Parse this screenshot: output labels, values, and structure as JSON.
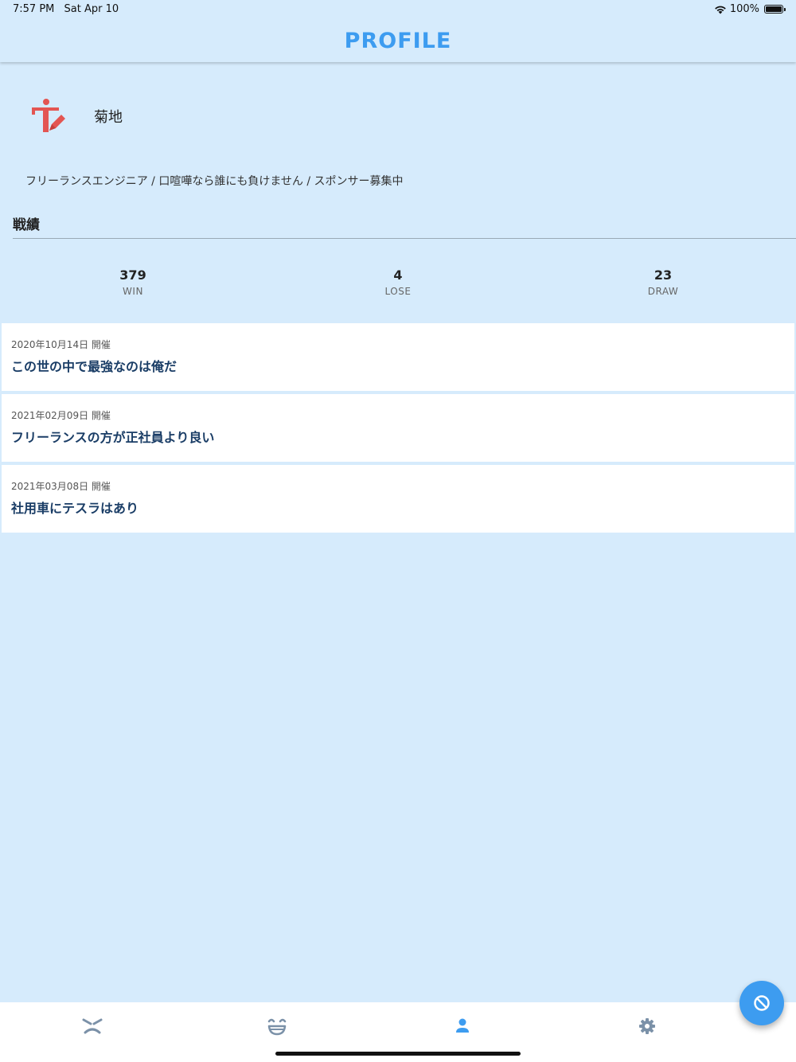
{
  "status_bar": {
    "time": "7:57 PM",
    "date": "Sat Apr 10",
    "battery_text": "100%",
    "icons": [
      "wifi-icon",
      "battery-icon"
    ]
  },
  "header": {
    "title": "PROFILE"
  },
  "profile": {
    "avatar_icon": "pedestrian-edit-icon",
    "name": "菊地",
    "bio": "フリーランスエンジニア / 口喧嘩なら誰にも負けません / スポンサー募集中"
  },
  "record": {
    "section_title": "戦績",
    "stats": [
      {
        "value": "379",
        "label": "WIN"
      },
      {
        "value": "4",
        "label": "LOSE"
      },
      {
        "value": "23",
        "label": "DRAW"
      }
    ]
  },
  "events": [
    {
      "date": "2020年10月14日 開催",
      "title": "この世の中で最強なのは俺だ"
    },
    {
      "date": "2021年02月09日 開催",
      "title": "フリーランスの方が正社員より良い"
    },
    {
      "date": "2021年03月08日 開催",
      "title": "社用車にテスラはあり"
    }
  ],
  "bottom_nav": {
    "items": [
      {
        "icon": "angry-face-icon",
        "active": false
      },
      {
        "icon": "laughing-face-icon",
        "active": false
      },
      {
        "icon": "person-icon",
        "active": true
      },
      {
        "icon": "gear-icon",
        "active": false
      }
    ]
  },
  "fab": {
    "icon": "block-icon"
  },
  "colors": {
    "background": "#d6ebfc",
    "accent": "#3d9cf0",
    "nav_inactive": "#7b91a8",
    "avatar": "#e35552",
    "event_title": "#1a3d66"
  }
}
